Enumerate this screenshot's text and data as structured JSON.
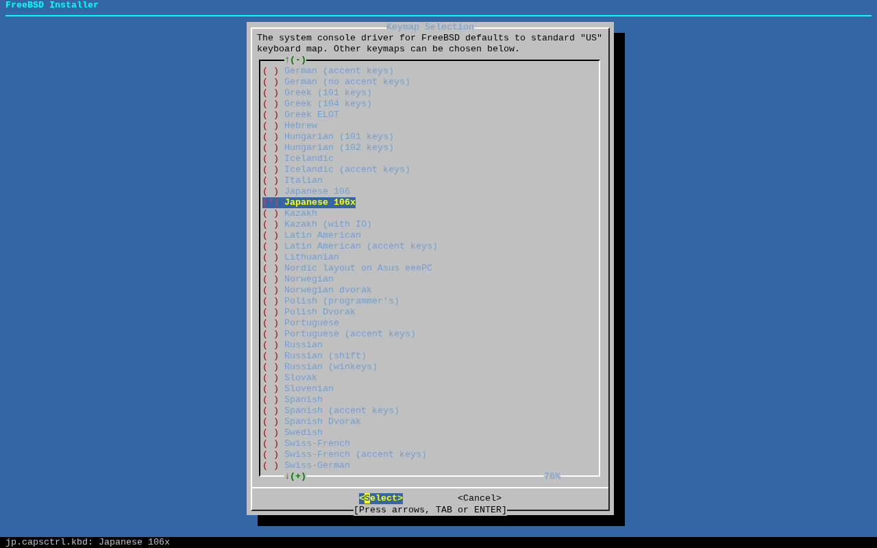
{
  "header": {
    "title": "FreeBSD Installer"
  },
  "dialog": {
    "title": "Keymap Selection",
    "description": "The system console driver for FreeBSD defaults to standard \"US\" keyboard map. Other keymaps can be chosen below.",
    "scroll_up": "↑(-)",
    "scroll_down": "↓(+)",
    "percent": "76%",
    "items": [
      {
        "radio": "( )",
        "label": "German (accent keys)",
        "selected": false
      },
      {
        "radio": "( )",
        "label": "German (no accent keys)",
        "selected": false
      },
      {
        "radio": "( )",
        "label": "Greek (101 keys)",
        "selected": false
      },
      {
        "radio": "( )",
        "label": "Greek (104 keys)",
        "selected": false
      },
      {
        "radio": "( )",
        "label": "Greek ELOT",
        "selected": false
      },
      {
        "radio": "( )",
        "label": "Hebrew",
        "selected": false
      },
      {
        "radio": "( )",
        "label": "Hungarian (101 keys)",
        "selected": false
      },
      {
        "radio": "( )",
        "label": "Hungarian (102 keys)",
        "selected": false
      },
      {
        "radio": "( )",
        "label": "Icelandic",
        "selected": false
      },
      {
        "radio": "( )",
        "label": "Icelandic (accent keys)",
        "selected": false
      },
      {
        "radio": "( )",
        "label": "Italian",
        "selected": false
      },
      {
        "radio": "( )",
        "label": "Japanese 106",
        "selected": false
      },
      {
        "radio": "(*)",
        "label": "Japanese 106x",
        "selected": true
      },
      {
        "radio": "( )",
        "label": "Kazakh",
        "selected": false
      },
      {
        "radio": "( )",
        "label": "Kazakh (with IO)",
        "selected": false
      },
      {
        "radio": "( )",
        "label": "Latin American",
        "selected": false
      },
      {
        "radio": "( )",
        "label": "Latin American (accent keys)",
        "selected": false
      },
      {
        "radio": "( )",
        "label": "Lithuanian",
        "selected": false
      },
      {
        "radio": "( )",
        "label": "Nordic layout on Asus eeePC",
        "selected": false
      },
      {
        "radio": "( )",
        "label": "Norwegian",
        "selected": false
      },
      {
        "radio": "( )",
        "label": "Norwegian dvorak",
        "selected": false
      },
      {
        "radio": "( )",
        "label": "Polish (programmer's)",
        "selected": false
      },
      {
        "radio": "( )",
        "label": "Polish Dvorak",
        "selected": false
      },
      {
        "radio": "( )",
        "label": "Portuguese",
        "selected": false
      },
      {
        "radio": "( )",
        "label": "Portuguese (accent keys)",
        "selected": false
      },
      {
        "radio": "( )",
        "label": "Russian",
        "selected": false
      },
      {
        "radio": "( )",
        "label": "Russian (shift)",
        "selected": false
      },
      {
        "radio": "( )",
        "label": "Russian (winkeys)",
        "selected": false
      },
      {
        "radio": "( )",
        "label": "Slovak",
        "selected": false
      },
      {
        "radio": "( )",
        "label": "Slovenian",
        "selected": false
      },
      {
        "radio": "( )",
        "label": "Spanish",
        "selected": false
      },
      {
        "radio": "( )",
        "label": "Spanish (accent keys)",
        "selected": false
      },
      {
        "radio": "( )",
        "label": "Spanish Dvorak",
        "selected": false
      },
      {
        "radio": "( )",
        "label": "Swedish",
        "selected": false
      },
      {
        "radio": "( )",
        "label": "Swiss-French",
        "selected": false
      },
      {
        "radio": "( )",
        "label": "Swiss-French (accent keys)",
        "selected": false
      },
      {
        "radio": "( )",
        "label": "Swiss-German",
        "selected": false
      }
    ],
    "buttons": [
      {
        "before": "<",
        "hotkey": "S",
        "after": "elect>",
        "selected": true
      },
      {
        "before": "<Cancel>",
        "selected": false
      }
    ],
    "hint": "[Press arrows, TAB or ENTER]"
  },
  "status_bar": {
    "text": "jp.capsctrl.kbd: Japanese 106x"
  }
}
